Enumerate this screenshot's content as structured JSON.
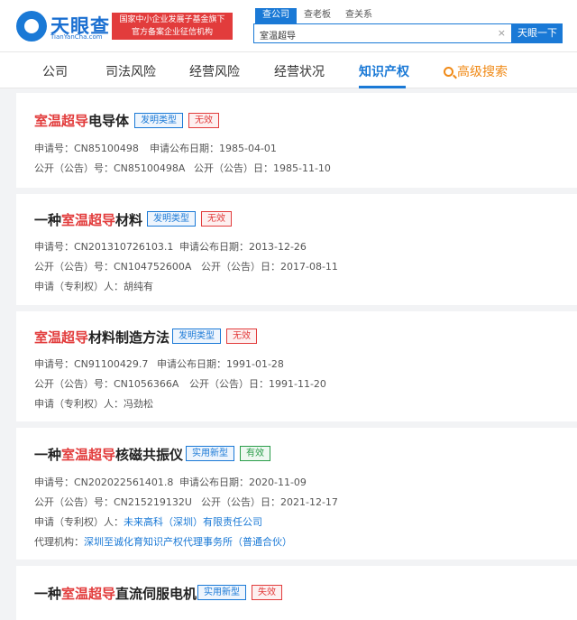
{
  "header": {
    "logo_name": "天眼查",
    "logo_url": "TianYanCha.com",
    "banner_line1": "国家中小企业发展子基金旗下",
    "banner_line2": "官方备案企业征信机构",
    "search_tabs": [
      "查公司",
      "查老板",
      "查关系"
    ],
    "search_value": "室温超导",
    "clear": "×",
    "search_button": "天眼一下"
  },
  "nav": {
    "items": [
      "公司",
      "司法风险",
      "经营风险",
      "经营状况",
      "知识产权",
      "高级搜索"
    ]
  },
  "labels": {
    "app_no": "申请号：",
    "pub_date": "申请公布日期：",
    "open_no": "公开（公告）号：",
    "open_date": "公开（公告）日：",
    "applicant": "申请（专利权）人：",
    "agency": "代理机构："
  },
  "patents": [
    {
      "prefix": "",
      "hl": "室温超导",
      "suffix": "电导体",
      "type_tag": "发明类型",
      "status_tag": "无效",
      "app_no": "CN85100498",
      "pub_date": "1985-04-01",
      "open_no": "CN85100498A",
      "open_date": "1985-11-10"
    },
    {
      "prefix": "一种",
      "hl": "室温超导",
      "suffix": "材料",
      "type_tag": "发明类型",
      "status_tag": "无效",
      "app_no": "CN201310726103.1",
      "pub_date": "2013-12-26",
      "open_no": "CN104752600A",
      "open_date": "2017-08-11",
      "applicant": "胡纯有"
    },
    {
      "prefix": "",
      "hl": "室温超导",
      "suffix": "材料制造方法",
      "type_tag": "发明类型",
      "status_tag": "无效",
      "app_no": "CN91100429.7",
      "pub_date": "1991-01-28",
      "open_no": "CN1056366A",
      "open_date": "1991-11-20",
      "applicant": "冯劲松"
    },
    {
      "prefix": "一种",
      "hl": "室温超导",
      "suffix": "核磁共振仪",
      "type_tag": "实用新型",
      "status_tag": "有效",
      "app_no": "CN202022561401.8",
      "pub_date": "2020-11-09",
      "open_no": "CN215219132U",
      "open_date": "2021-12-17",
      "applicant": "未来高科（深圳）有限责任公司",
      "agency": "深圳至诚化育知识产权代理事务所（普通合伙）"
    },
    {
      "prefix": "一种",
      "hl": "室温超导",
      "suffix": "直流伺服电机",
      "type_tag": "实用新型",
      "status_tag": "失效"
    }
  ],
  "colors": {
    "brand": "#1a79d6",
    "highlight": "#e23c3c",
    "valid": "#2a9d4a",
    "advanced_search": "#f08a17"
  }
}
